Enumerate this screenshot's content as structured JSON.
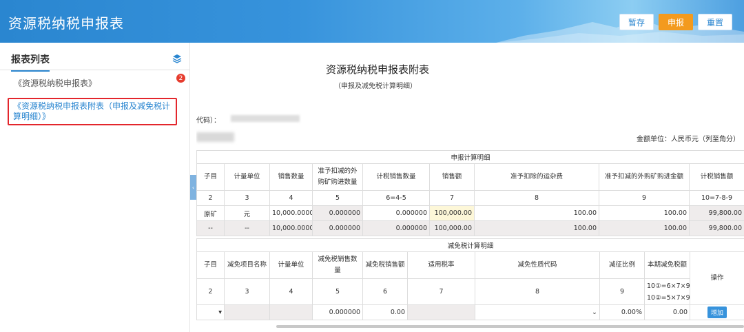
{
  "header": {
    "title": "资源税纳税申报表",
    "buttons": {
      "save": "暂存",
      "submit": "申报",
      "reset": "重置"
    }
  },
  "sidebar": {
    "title": "报表列表",
    "icon": "layers-icon",
    "items": [
      {
        "label": "《资源税纳税申报表》",
        "badge": "2"
      },
      {
        "label": "《资源税纳税申报表附表（申报及减免税计算明细）》"
      }
    ]
  },
  "document": {
    "title": "资源税纳税申报表附表",
    "subtitle": "（申报及减免税计算明细）",
    "code_label": "代码）：",
    "amount_unit": "金额单位：人民币元（列至角分）"
  },
  "table1": {
    "section": "申报计算明细",
    "headers": [
      "子目",
      "计量单位",
      "销售数量",
      "准予扣减的外购矿购进数量",
      "计税销售数量",
      "销售额",
      "准予扣除的运杂费",
      "准予扣减的外购矿购进金额",
      "计税销售额"
    ],
    "numbers": [
      "2",
      "3",
      "4",
      "5",
      "6=4-5",
      "7",
      "8",
      "9",
      "10=7-8-9"
    ],
    "rows": [
      [
        "原矿",
        "元",
        "10,000.000000",
        "0.000000",
        "0.000000",
        "100,000.00",
        "100.00",
        "100.00",
        "99,800.00"
      ],
      [
        "--",
        "--",
        "10,000.000000",
        "0.000000",
        "0.000000",
        "100,000.00",
        "100.00",
        "100.00",
        "99,800.00"
      ]
    ]
  },
  "table2": {
    "section": "减免税计算明细",
    "headers": [
      "子目",
      "减免项目名称",
      "计量单位",
      "减免税销售数量",
      "减免税销售额",
      "适用税率",
      "减免性质代码",
      "减征比例",
      "本期减免税额",
      "操作"
    ],
    "numbers": [
      "2",
      "3",
      "4",
      "5",
      "6",
      "7",
      "8",
      "9"
    ],
    "formula1": "10①=6×7×9",
    "formula2": "10②=5×7×9",
    "row": [
      "",
      "",
      "",
      "0.000000",
      "0.00",
      "",
      "",
      "0.00%",
      "0.00"
    ],
    "add_label": "增加"
  }
}
